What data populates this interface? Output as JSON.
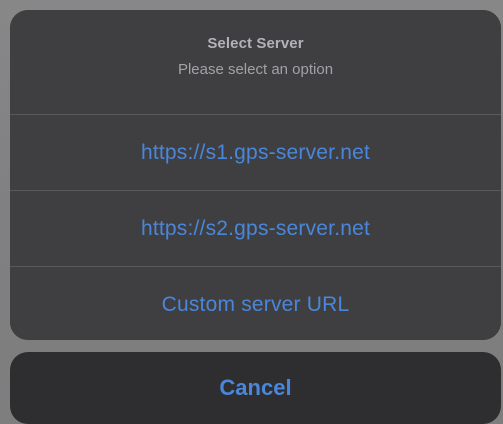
{
  "sheet": {
    "title": "Select Server",
    "subtitle": "Please select an option",
    "actions": [
      {
        "label": "https://s1.gps-server.net"
      },
      {
        "label": "https://s2.gps-server.net"
      },
      {
        "label": "Custom server URL"
      }
    ]
  },
  "cancel": {
    "label": "Cancel"
  },
  "colors": {
    "backdrop": "#808080",
    "sheet_background": "#3f3f41",
    "cancel_background": "#2e2e30",
    "action_text": "#4a86d9",
    "title_text": "#b3b3b7",
    "subtitle_text": "#a2a2a6",
    "divider": "#59595c"
  }
}
